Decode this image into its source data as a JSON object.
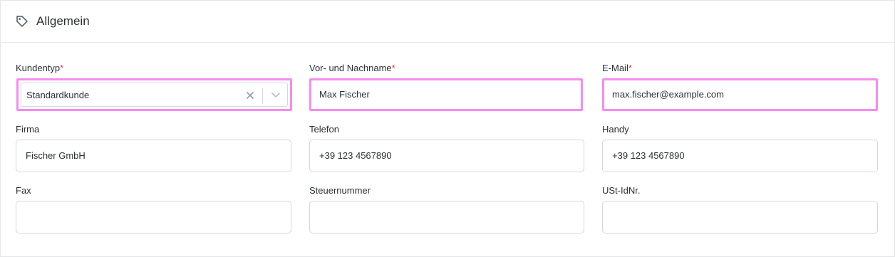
{
  "section": {
    "title": "Allgemein",
    "icon": "tag-icon"
  },
  "required_marker": "*",
  "fields": {
    "kundentyp": {
      "label": "Kundentyp",
      "value": "Standardkunde"
    },
    "name": {
      "label": "Vor- und Nachname",
      "value": "Max Fischer"
    },
    "email": {
      "label": "E-Mail",
      "value": "max.fischer@example.com"
    },
    "firma": {
      "label": "Firma",
      "value": "Fischer GmbH"
    },
    "telefon": {
      "label": "Telefon",
      "value": "+39 123 4567890"
    },
    "handy": {
      "label": "Handy",
      "value": "+39 123 4567890"
    },
    "fax": {
      "label": "Fax",
      "value": ""
    },
    "steuernummer": {
      "label": "Steuernummer",
      "value": ""
    },
    "ustid": {
      "label": "USt-IdNr.",
      "value": ""
    }
  },
  "colors": {
    "highlight": "#f58cf1",
    "required": "#e03a3a",
    "border": "#d4d7dc"
  }
}
